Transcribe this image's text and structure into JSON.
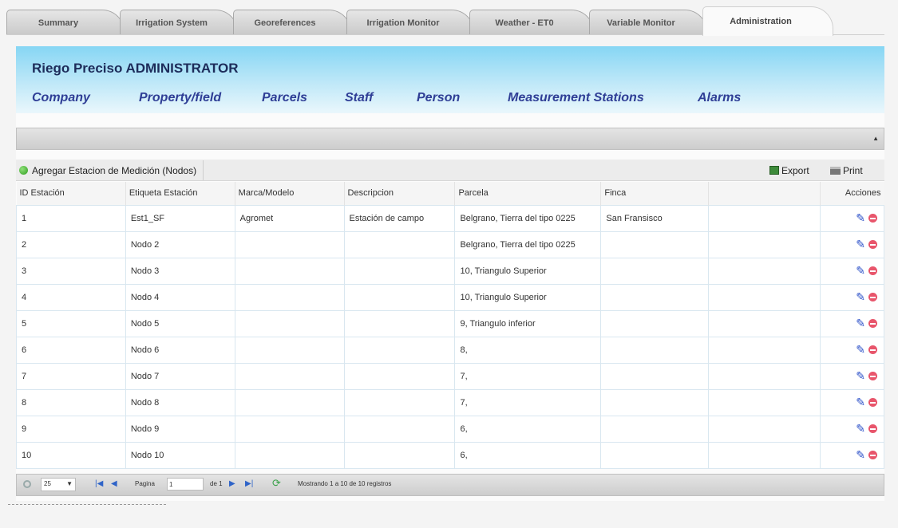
{
  "tabs": [
    {
      "label": "Summary"
    },
    {
      "label": "Irrigation System"
    },
    {
      "label": "Georeferences"
    },
    {
      "label": "Irrigation Monitor"
    },
    {
      "label": "Weather - ET0"
    },
    {
      "label": "Variable Monitor"
    },
    {
      "label": "Administration",
      "active": true
    }
  ],
  "admin": {
    "title": "Riego Preciso ADMINISTRATOR",
    "nav": [
      "Company",
      "Property/field",
      "Parcels",
      "Staff",
      "Person",
      "Measurement Stations",
      "Alarms"
    ]
  },
  "toolbar": {
    "add_label": "Agregar Estacion de Medición (Nodos)",
    "export_label": "Export",
    "print_label": "Print"
  },
  "table": {
    "columns": [
      "ID Estación",
      "Etiqueta Estación",
      "Marca/Modelo",
      "Descripcion",
      "Parcela",
      "Finca",
      "",
      "Acciones"
    ],
    "rows": [
      [
        "1",
        "Est1_SF",
        "Agromet",
        "Estación de campo",
        "Belgrano,  Tierra del tipo 0225",
        "San Fransisco",
        ""
      ],
      [
        "2",
        "Nodo 2",
        "",
        "",
        "Belgrano,  Tierra del tipo 0225",
        "",
        ""
      ],
      [
        "3",
        "Nodo 3",
        "",
        "",
        "10,  Triangulo Superior",
        "",
        ""
      ],
      [
        "4",
        "Nodo 4",
        "",
        "",
        "10,  Triangulo Superior",
        "",
        ""
      ],
      [
        "5",
        "Nodo 5",
        "",
        "",
        "9,  Triangulo inferior",
        "",
        ""
      ],
      [
        "6",
        "Nodo 6",
        "",
        "",
        "8,",
        "",
        ""
      ],
      [
        "7",
        "Nodo 7",
        "",
        "",
        "7,",
        "",
        ""
      ],
      [
        "8",
        "Nodo 8",
        "",
        "",
        "7,",
        "",
        ""
      ],
      [
        "9",
        "Nodo 9",
        "",
        "",
        "6,",
        "",
        ""
      ],
      [
        "10",
        "Nodo 10",
        "",
        "",
        "6,",
        "",
        ""
      ]
    ]
  },
  "pager": {
    "page_size": "25",
    "page_label": "Pagina",
    "page_value": "1",
    "of_label": "de 1",
    "records_text": "Mostrando 1 a 10 de 10 registros"
  }
}
